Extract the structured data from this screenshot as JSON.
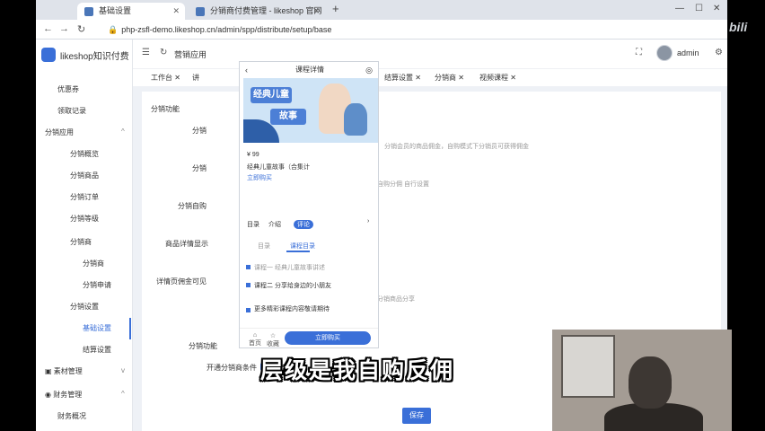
{
  "browser": {
    "tabs": [
      {
        "title": "基础设置"
      },
      {
        "title": "分销商付费管理 - likeshop 官网 ..."
      }
    ],
    "url": "php-zsfl-demo.likeshop.cn/admin/spp/distribute/setup/base"
  },
  "sidebar": {
    "logo_text": "likeshop知识付费",
    "items": [
      {
        "label": "优惠券",
        "selected": false
      },
      {
        "label": "领取记录",
        "selected": false
      },
      {
        "label": "分销应用",
        "selected": false,
        "expandable": true
      },
      {
        "label": "分销概览",
        "selected": false
      },
      {
        "label": "分销商品",
        "selected": false
      },
      {
        "label": "分销订单",
        "selected": false
      },
      {
        "label": "分销等级",
        "selected": false
      },
      {
        "label": "分销商",
        "selected": false,
        "expandable": true
      },
      {
        "label": "分销商",
        "selected": false
      },
      {
        "label": "分销申请",
        "selected": false
      },
      {
        "label": "分销设置",
        "selected": false,
        "expandable": true
      },
      {
        "label": "基础设置",
        "selected": true
      },
      {
        "label": "结算设置",
        "selected": false
      },
      {
        "label": "素材管理",
        "selected": false,
        "expandable": true
      },
      {
        "label": "财务管理",
        "selected": false,
        "expandable": true
      },
      {
        "label": "财务概况",
        "selected": false
      }
    ]
  },
  "topnav": {
    "app_label": "营销应用",
    "user": "admin"
  },
  "tabstrip": [
    {
      "label": "工作台"
    },
    {
      "label": "讲"
    },
    {
      "label": "结算设置"
    },
    {
      "label": "分销商"
    },
    {
      "label": "视频课程"
    }
  ],
  "form": {
    "section_title": "分销功能",
    "rows": [
      {
        "label": "分销"
      },
      {
        "label": "分销"
      },
      {
        "label": "分销自购"
      },
      {
        "label": "商品详情显示"
      },
      {
        "label": "详情页佣金可见"
      }
    ],
    "section2_title": "分销功能",
    "open_label": "开通分销商条件",
    "open_value": "无条件",
    "right_notes": [
      "分销会员的商品佣金，自购模式下分销员可获得佣金",
      "自购分佣 自行设置",
      "分销商品分享"
    ],
    "save_label": "保存"
  },
  "phone": {
    "title": "课程详情",
    "banner_line1": "经典儿童",
    "banner_line2": "故事",
    "price": "¥ 99",
    "course_title": "经典儿童故事（合集计",
    "promo": "立即购买",
    "tabs": [
      "目录",
      "介绍",
      "评论"
    ],
    "subtabs": [
      "目录",
      "课程目录"
    ],
    "list": [
      "课程一 经典儿童故事讲述",
      "课程二 分享给身边的小朋友",
      "更多精彩课程内容敬请期待"
    ],
    "buy_label": "立即购买",
    "footer": [
      "首页",
      "收藏"
    ]
  },
  "subtitle": "层级是我自购反佣",
  "watermark": "bili"
}
